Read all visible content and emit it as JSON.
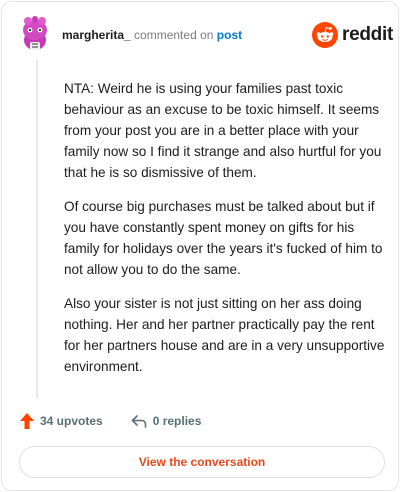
{
  "header": {
    "username": "margherita_",
    "commented_on_text": "commented on",
    "post_link_label": "post",
    "logo_text": "reddit"
  },
  "comment": {
    "paragraphs": [
      "NTA: Weird he is using your families past toxic behaviour as an excuse to be toxic himself. It seems from your post you are in a better place with your family now so I find it strange and also hurtful for you that he is so dismissive of them.",
      "Of course big purchases must be talked about but if you have constantly spent money on gifts for his family for holidays over the years it's fucked of him to not allow you to do the same.",
      "Also your sister is not just sitting on her ass doing nothing. Her and her partner practically pay the rent for her partners house and are in a very unsupportive environment."
    ]
  },
  "actions": {
    "upvotes_label": "34 upvotes",
    "replies_label": "0 replies"
  },
  "footer": {
    "view_conversation_label": "View the conversation"
  },
  "colors": {
    "brand": "#ff4500",
    "link": "#0079d3",
    "button_text": "#e64a1a",
    "avatar": "#c43bb5"
  },
  "icons": {
    "avatar": "snoo-avatar-icon",
    "logo": "reddit-logo-icon",
    "upvote": "upvote-arrow-icon",
    "reply": "reply-arrow-icon"
  }
}
